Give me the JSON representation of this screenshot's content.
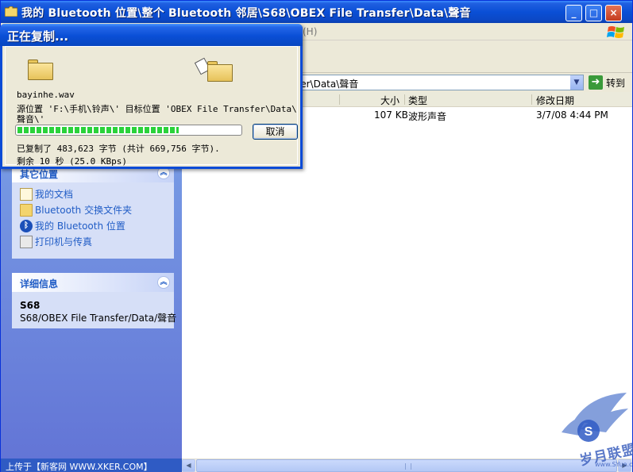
{
  "window": {
    "title": "我的 Bluetooth 位置\\整个 Bluetooth 邻居\\S68\\OBEX File Transfer\\Data\\聲音",
    "controls": [
      "minimize",
      "maximize",
      "close"
    ]
  },
  "menubar": {
    "partial_text": "(H)"
  },
  "addressbar": {
    "value": "fer\\Data\\聲音",
    "go_label": "转到"
  },
  "taskpane": {
    "other_places": {
      "title": "其它位置",
      "items": [
        {
          "label": "我的文档",
          "icon": "documents-icon"
        },
        {
          "label": "Bluetooth 交换文件夹",
          "icon": "folder-icon"
        },
        {
          "label": "我的 Bluetooth 位置",
          "icon": "bluetooth-icon"
        },
        {
          "label": "打印机与传真",
          "icon": "printer-icon"
        }
      ]
    },
    "details": {
      "title": "详细信息",
      "name": "S68",
      "path": "S68/OBEX File Transfer/Data/聲音"
    }
  },
  "filelist": {
    "columns": [
      "大小",
      "类型",
      "修改日期"
    ],
    "rows": [
      {
        "size": "107 KB",
        "type": "波形声音",
        "modified": "3/7/08 4:44 PM"
      }
    ]
  },
  "copy_dialog": {
    "title": "正在复制...",
    "filename": "bayinhe.wav",
    "source_line1": "源位置 'F:\\手机\\铃声\\' 目标位置 'OBEX File Transfer\\Data\\",
    "source_line2": "聲音\\'",
    "progress_fraction": 0.72,
    "copied_text": "已复制了 483,623 字节 (共计 669,756 字节).",
    "remaining_text": "剩余 10 秒 (25.0 KBps)",
    "cancel_label": "取消"
  },
  "status_left": "上传于【新客网 WWW.XKER.COM】",
  "watermark": {
    "text": "岁月联盟",
    "url": "www.SYue.com"
  },
  "colors": {
    "titlebar": "#0a4fd6",
    "taskpane": "#7ba2e7",
    "progress": "#2bd23b"
  }
}
